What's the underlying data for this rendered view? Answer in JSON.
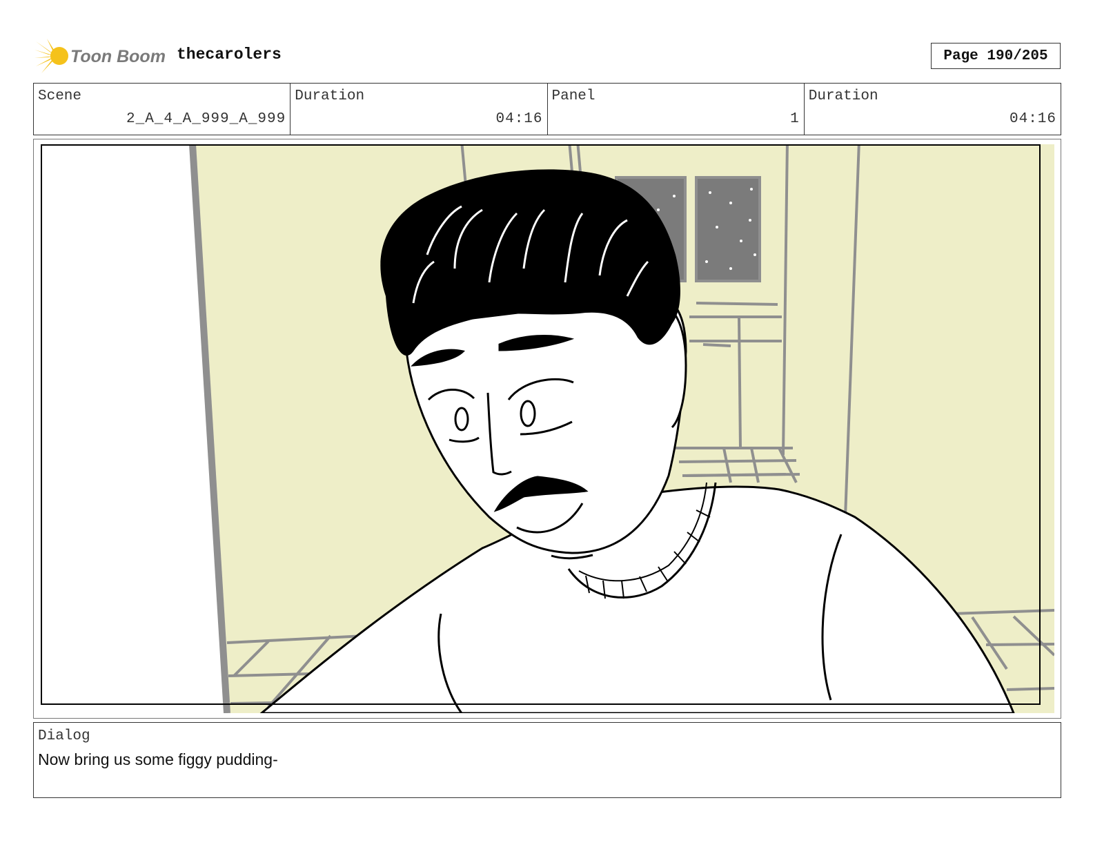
{
  "header": {
    "logo_text": "Toon Boom",
    "project_title": "thecarolers",
    "page_indicator": "Page 190/205"
  },
  "info": {
    "scene_label": "Scene",
    "scene_value": "2_A_4_A_999_A_999",
    "scene_duration_label": "Duration",
    "scene_duration_value": "04:16",
    "panel_label": "Panel",
    "panel_value": "1",
    "panel_duration_label": "Duration",
    "panel_duration_value": "04:16"
  },
  "dialog": {
    "label": "Dialog",
    "text": "Now bring us some figgy pudding-"
  },
  "colors": {
    "logo_yellow": "#f5c21b",
    "wall": "#eeeec8",
    "line_gray": "#8f8f8f",
    "ink": "#000000"
  }
}
